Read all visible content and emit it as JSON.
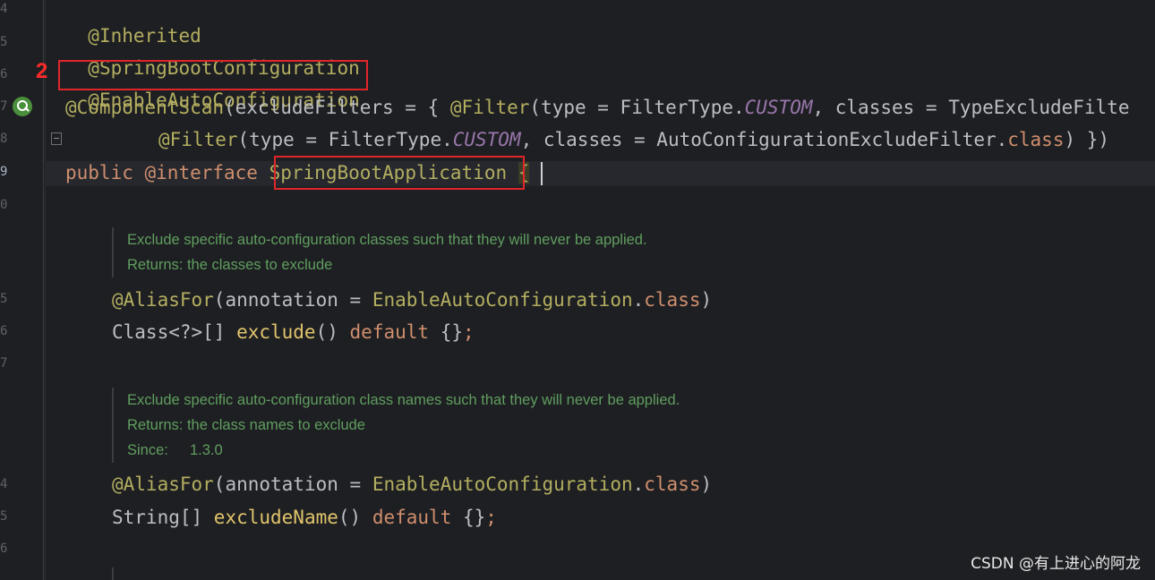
{
  "gutter": {
    "line_numbers": [
      "4",
      "5",
      "6",
      "7",
      "8",
      "9",
      "0",
      "5",
      "6",
      "7",
      "4",
      "5",
      "6"
    ]
  },
  "annotation_marker": "2",
  "code": {
    "line1": "@Inherited",
    "line2": "@SpringBootConfiguration",
    "line3": "@EnableAutoConfiguration",
    "line4": {
      "a1": "@ComponentScan",
      "a2": "(excludeFilters = { ",
      "a3": "@Filter",
      "a4": "(type = FilterType.",
      "a5": "CUSTOM",
      "a6": ", classes = TypeExcludeFilte"
    },
    "line5": {
      "a1": "@Filter",
      "a2": "(type = FilterType.",
      "a3": "CUSTOM",
      "a4": ", classes = AutoConfigurationExcludeFilter.",
      "a5": "class",
      "a6": ") })"
    },
    "line6": {
      "kw1": "public",
      "kw2": "@interface",
      "name": "SpringBootApplication",
      "brace": "{"
    },
    "doc1": {
      "text": "Exclude specific auto-configuration classes such that they will never be applied.",
      "returns_label": "Returns:",
      "returns_text": "the classes to exclude"
    },
    "line7": {
      "ann": "@AliasFor",
      "a2": "(annotation = ",
      "a3": "EnableAutoConfiguration",
      "a4": ".",
      "a5": "class",
      "a6": ")"
    },
    "line8": {
      "type": "Class<?>[] ",
      "method": "exclude",
      "a3": "() ",
      "kw": "default",
      "a5": " {}",
      "semi": ";"
    },
    "doc2": {
      "text": "Exclude specific auto-configuration class names such that they will never be applied.",
      "returns_label": "Returns:",
      "returns_text": "the class names to exclude",
      "since_label": "Since:",
      "since_text": "1.3.0"
    },
    "line9": {
      "ann": "@AliasFor",
      "a2": "(annotation = ",
      "a3": "EnableAutoConfiguration",
      "a4": ".",
      "a5": "class",
      "a6": ")"
    },
    "line10": {
      "type": "String[] ",
      "method": "excludeName",
      "a3": "() ",
      "kw": "default",
      "a5": " {}",
      "semi": ";"
    }
  },
  "watermark": "CSDN @有上进心的阿龙",
  "colors": {
    "highlight_box": "#e0262a",
    "annotation": "#b3ae60",
    "keyword": "#cf8e6d",
    "doc_comment": "#5f9e5f"
  }
}
